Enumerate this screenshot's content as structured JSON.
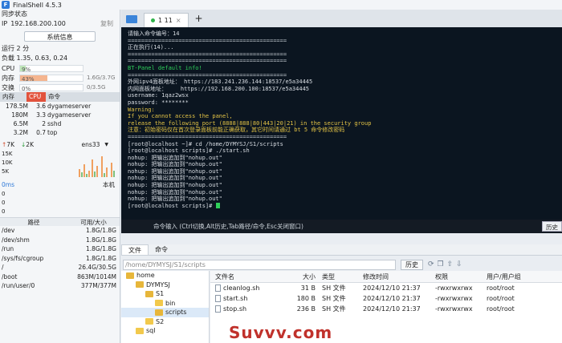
{
  "app": {
    "title": "FinalShell 4.5.3"
  },
  "left": {
    "sync": "同步状态",
    "ip_label": "IP",
    "ip": "192.168.200.100",
    "copy": "复制",
    "sysinfo": "系统信息",
    "uptime": "运行 2 分",
    "load": "负载 1.35, 0.63, 0.24",
    "cpu": {
      "label": "CPU",
      "value": "9%",
      "level": 9
    },
    "mem": {
      "label": "内存",
      "value": "43%",
      "detail": "1.6G/3.7G",
      "level": 43
    },
    "swap": {
      "label": "交换",
      "value": "0%",
      "detail": "0/3.5G",
      "level": 0
    },
    "proc_tabs": [
      "内存",
      "CPU",
      "命令"
    ],
    "procs": [
      {
        "mem": "178.5M",
        "cpu": "3.6",
        "cmd": "dygameserver"
      },
      {
        "mem": "180M",
        "cpu": "3.3",
        "cmd": "dygameserver"
      },
      {
        "mem": "6.5M",
        "cpu": "2",
        "cmd": "sshd"
      },
      {
        "mem": "3.2M",
        "cpu": "0.7",
        "cmd": "top"
      }
    ],
    "net": {
      "up": "7K",
      "down": "2K",
      "iface": "ens33",
      "ticks": [
        "15K",
        "10K",
        "5K"
      ]
    },
    "latency": {
      "label": "0ms",
      "local": "本机",
      "ticks": [
        "0",
        "0",
        "0"
      ]
    },
    "disk_headers": [
      "路径",
      "可用/大小"
    ],
    "disks": [
      {
        "path": "/dev",
        "size": "1.8G/1.8G"
      },
      {
        "path": "/dev/shm",
        "size": "1.8G/1.8G"
      },
      {
        "path": "/run",
        "size": "1.8G/1.8G"
      },
      {
        "path": "/sys/fs/cgroup",
        "size": "1.8G/1.8G"
      },
      {
        "path": "/",
        "size": "26.4G/30.5G"
      },
      {
        "path": "/boot",
        "size": "863M/1014M"
      },
      {
        "path": "/run/user/0",
        "size": "377M/377M"
      }
    ]
  },
  "session": {
    "tab": "1 11",
    "plus": "+"
  },
  "terminal": {
    "lines": [
      {
        "t": "请输入命令编号：14",
        "c": ""
      },
      {
        "t": "===============================================",
        "c": "sep"
      },
      {
        "t": "正在执行(14)...",
        "c": ""
      },
      {
        "t": "===============================================",
        "c": "sep"
      },
      {
        "t": "===============================================",
        "c": "sep"
      },
      {
        "t": "BT-Panel default info!",
        "c": "g"
      },
      {
        "t": "===============================================",
        "c": "sep"
      },
      {
        "t": "外网ipv4面板地址： https://183.241.236.144:18537/e5a34445",
        "c": ""
      },
      {
        "t": "内网面板地址：    https://192.168.200.100:18537/e5a34445",
        "c": ""
      },
      {
        "t": "username: 1qaz2wsx",
        "c": ""
      },
      {
        "t": "password: ********",
        "c": ""
      },
      {
        "t": "Warning:",
        "c": "y"
      },
      {
        "t": "If you cannot access the panel,",
        "c": "y"
      },
      {
        "t": "release the following port (8888|888|80|443|20|21) in the security group",
        "c": "y"
      },
      {
        "t": "注意：初始密码仅在首次登录面板前能正确获取，其它时间请通过 bt 5 命令修改密码",
        "c": "y"
      },
      {
        "t": "===============================================",
        "c": "sep"
      },
      {
        "t": "[root@localhost ~]# cd /home/DYMYSJ/S1/scripts",
        "c": ""
      },
      {
        "t": "[root@localhost scripts]# ./start.sh",
        "c": ""
      },
      {
        "t": "nohup: 把输出追加到\"nohup.out\"",
        "c": ""
      },
      {
        "t": "nohup: 把输出追加到\"nohup.out\"",
        "c": ""
      },
      {
        "t": "nohup: 把输出追加到\"nohup.out\"",
        "c": ""
      },
      {
        "t": "nohup: 把输出追加到\"nohup.out\"",
        "c": ""
      },
      {
        "t": "nohup: 把输出追加到\"nohup.out\"",
        "c": ""
      },
      {
        "t": "nohup: 把输出追加到\"nohup.out\"",
        "c": ""
      },
      {
        "t": "nohup: 把输出追加到\"nohup.out\"",
        "c": ""
      },
      {
        "t": "[root@localhost scripts]# ",
        "c": ""
      }
    ]
  },
  "cmdbar": {
    "hint": "命令输入 (Ctrl切换,Alt历史,Tab路径/命令,Esc关闭窗口)",
    "history": "历史"
  },
  "bottom": {
    "tabs": [
      "文件",
      "命令"
    ],
    "path": "/home/DYMYSJ/S1/scripts",
    "history": "历史",
    "tree": [
      "home",
      "DYMYSJ",
      "S1",
      "bin",
      "scripts",
      "S2",
      "sql"
    ],
    "headers": [
      "文件名",
      "大小",
      "类型",
      "修改时间",
      "权限",
      "用户/用户组"
    ],
    "files": [
      {
        "name": "cleanlog.sh",
        "size": "31 B",
        "type": "SH 文件",
        "mtime": "2024/12/10 21:37",
        "perm": "-rwxrwxrwx",
        "owner": "root/root"
      },
      {
        "name": "start.sh",
        "size": "180 B",
        "type": "SH 文件",
        "mtime": "2024/12/10 21:37",
        "perm": "-rwxrwxrwx",
        "owner": "root/root"
      },
      {
        "name": "stop.sh",
        "size": "236 B",
        "type": "SH 文件",
        "mtime": "2024/12/10 21:37",
        "perm": "-rwxrwxrwx",
        "owner": "root/root"
      }
    ]
  },
  "watermark": "Suvvv.com",
  "colors": {
    "terminal_bg": "#0b1520",
    "green": "#2fd05a",
    "yellow": "#e2c245",
    "accent": "#2f7ad8",
    "mem_fill": "#f5b58f",
    "cpu_fill": "#bfe6b8"
  }
}
